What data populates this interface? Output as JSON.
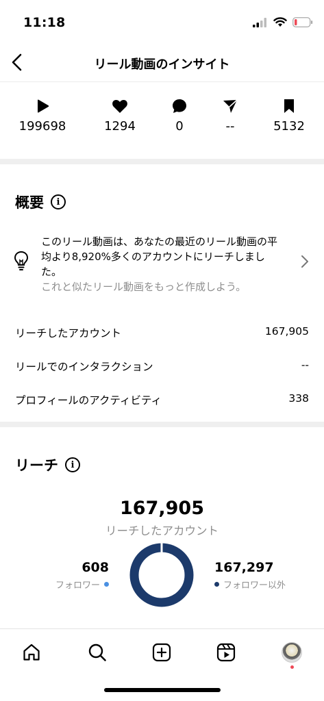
{
  "status_bar": {
    "time": "11:18"
  },
  "nav": {
    "title": "リール動画のインサイト"
  },
  "metrics": [
    {
      "icon": "play-icon",
      "value": "199698"
    },
    {
      "icon": "heart-icon",
      "value": "1294"
    },
    {
      "icon": "comment-icon",
      "value": "0"
    },
    {
      "icon": "share-icon",
      "value": "--"
    },
    {
      "icon": "save-icon",
      "value": "5132"
    }
  ],
  "overview": {
    "title": "概要",
    "insight_text": "このリール動画は、あなたの最近のリール動画の平均より8,920%多くのアカウントにリーチしました。",
    "insight_sub": "これと似たリール動画をもっと作成しよう。",
    "rows": [
      {
        "label": "リーチしたアカウント",
        "value": "167,905"
      },
      {
        "label": "リールでのインタラクション",
        "value": "--"
      },
      {
        "label": "プロフィールのアクティビティ",
        "value": "338"
      }
    ]
  },
  "reach": {
    "title": "リーチ",
    "total": "167,905",
    "total_label": "リーチしたアカウント",
    "followers": {
      "value": "608",
      "label": "フォロワー",
      "color": "#4a90e2"
    },
    "non_followers": {
      "value": "167,297",
      "label": "フォロワー以外",
      "color": "#1c3a6b"
    }
  },
  "tab_bar": {
    "items": [
      "home-icon",
      "search-icon",
      "create-icon",
      "reels-icon",
      "profile-avatar"
    ]
  },
  "colors": {
    "donut_primary": "#1c3a6b",
    "donut_secondary": "#4a90e2",
    "divider": "#efefef"
  }
}
